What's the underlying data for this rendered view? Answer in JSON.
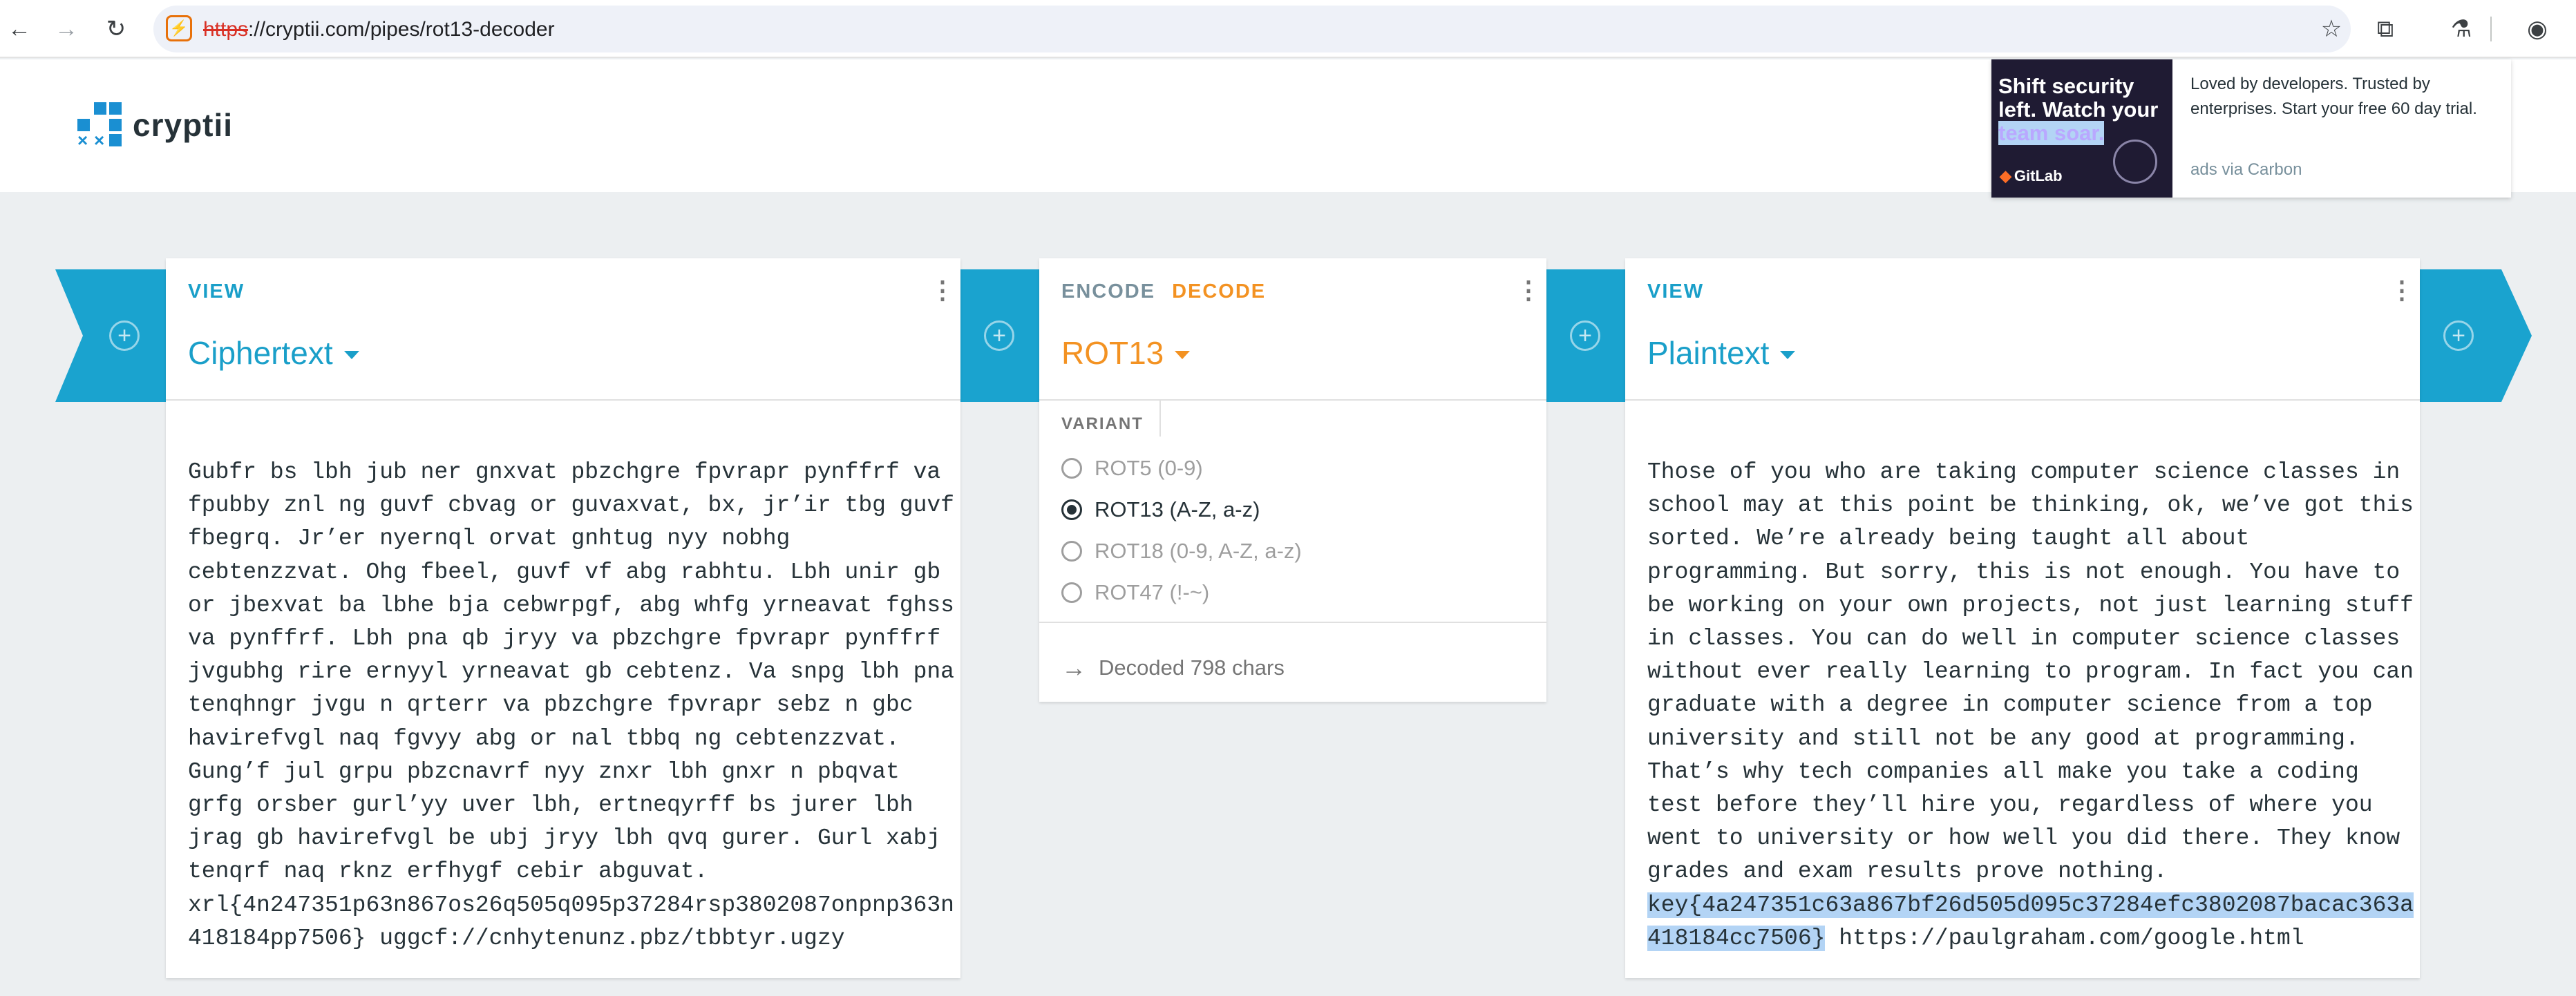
{
  "browser": {
    "url_scheme": "https",
    "url_rest": "://cryptii.com/pipes/rot13-decoder",
    "back_icon": "arrow-left-icon",
    "forward_icon": "arrow-right-icon",
    "reload_icon": "reload-icon"
  },
  "site": {
    "logo_text": "cryptii",
    "brand_color": "#1a8fd2"
  },
  "ad": {
    "headline_1": "Shift security left. Watch your",
    "headline_2": "team soar.",
    "brand": "GitLab",
    "copy": "Loved by developers. Trusted by enterprises. Start your free 60 day trial.",
    "via": "ads via Carbon"
  },
  "bricks": {
    "input": {
      "tab": "VIEW",
      "title": "Ciphertext",
      "content": "Gubfr bs lbh jub ner gnxvat pbzchgre fpvrapr pynffrf va\nfpubby znl ng guvf cbvag or guvaxvat, bx, jr’ir tbg guvf\nfbegrq. Jr’er nyernql orvat gnhtug nyy nobhg\ncebtenzzvat. Ohg fbeel, guvf vf abg rabhtu. Lbh unir gb\nor jbexvat ba lbhe bja cebwrpgf, abg whfg yrneavat fghss\nva pynffrf. Lbh pna qb jryy va pbzchgre fpvrapr pynffrf\njvgubhg rire ernyyl yrneavat gb cebtenz. Va snpg lbh pna\ntenqhngr jvgu n qrterr va pbzchgre fpvrapr sebz n gbc\nhavirefvgl naq fgvyy abg or nal tbbq ng cebtenzzvat.\nGung’f jul grpu pbzcnavrf nyy znxr lbh gnxr n pbqvat\ngrfg orsber gurl’yy uver lbh, ertneqyrff bs jurer lbh\njrag gb havirefvgl be ubj jryy lbh qvq gurer. Gurl xabj\ntenqrf naq rknz erfhygf cebir abguvat.\nxrl{4n247351p63n867os26q505q095p37284rsp3802087onpnp363n\n418184pp7506} uggcf://cnhytenunz.pbz/tbbtyr.ugzy"
    },
    "encoder": {
      "tab_encode": "ENCODE",
      "tab_decode": "DECODE",
      "title": "ROT13",
      "variant_label": "VARIANT",
      "variants": [
        {
          "label": "ROT5 (0-9)",
          "selected": false
        },
        {
          "label": "ROT13 (A-Z, a-z)",
          "selected": true
        },
        {
          "label": "ROT18 (0-9, A-Z, a-z)",
          "selected": false
        },
        {
          "label": "ROT47 (!-~)",
          "selected": false
        }
      ],
      "status": "Decoded 798 chars"
    },
    "output": {
      "tab": "VIEW",
      "title": "Plaintext",
      "content_plain": "Those of you who are taking computer science classes in\nschool may at this point be thinking, ok, we’ve got this\nsorted. We’re already being taught all about\nprogramming. But sorry, this is not enough. You have to\nbe working on your own projects, not just learning stuff\nin classes. You can do well in computer science classes\nwithout ever really learning to program. In fact you can\ngraduate with a degree in computer science from a top\nuniversity and still not be any good at programming.\nThat’s why tech companies all make you take a coding\ntest before they’ll hire you, regardless of where you\nwent to university or how well you did there. They know\ngrades and exam results prove nothing.\n",
      "content_selected": "key{4a247351c63a867bf26d505d095c37284efc3802087bacac363a\n418184cc7506}",
      "content_tail": " https://paulgraham.com/google.html"
    }
  },
  "colors": {
    "connector": "#1aa3cf",
    "decode_accent": "#f39222",
    "view_accent": "#1a9fc9",
    "selection": "#b3d4f5"
  }
}
